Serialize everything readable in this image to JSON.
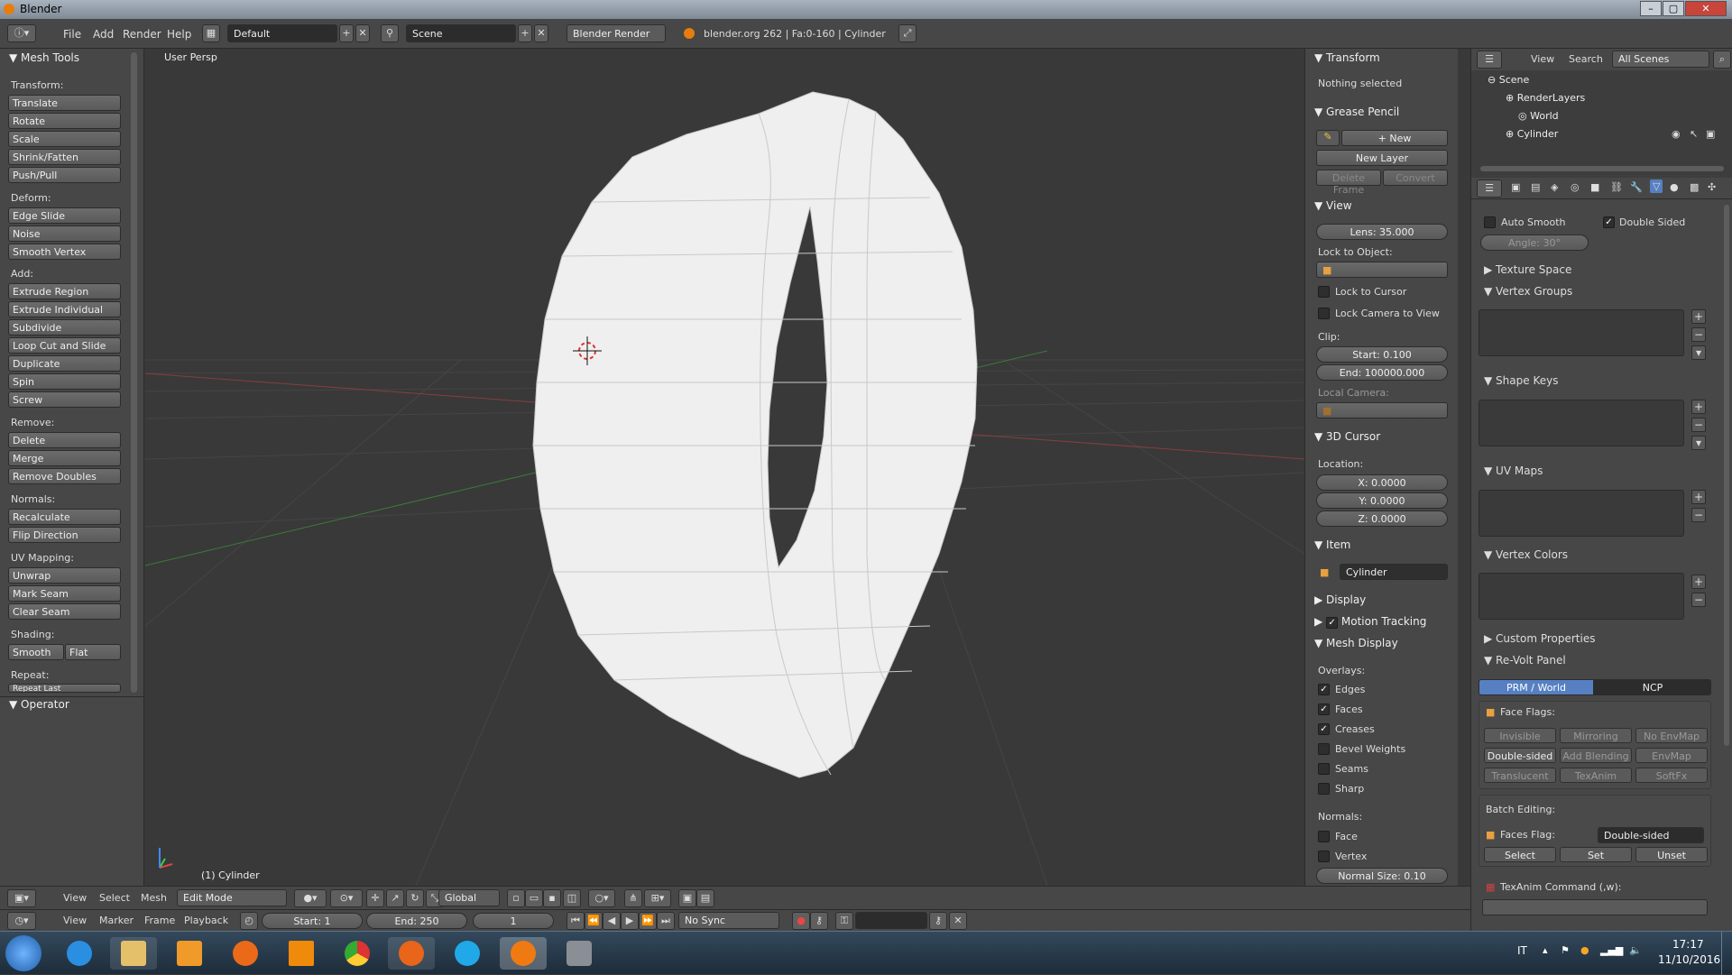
{
  "window": {
    "title": "Blender",
    "min": "–",
    "max": "▢",
    "close": "✕"
  },
  "topbar": {
    "menus": [
      "File",
      "Add",
      "Render",
      "Help"
    ],
    "layout": "Default",
    "scene": "Scene",
    "engine": "Blender Render",
    "info": "blender.org 262 | Fa:0-160 | Cylinder"
  },
  "toolshelf": {
    "title": "Mesh Tools",
    "groups": {
      "transform": "Transform:",
      "deform": "Deform:",
      "add": "Add:",
      "remove": "Remove:",
      "normals": "Normals:",
      "uv": "UV Mapping:",
      "shading": "Shading:",
      "repeat": "Repeat:"
    },
    "buttons": {
      "translate": "Translate",
      "rotate": "Rotate",
      "scale": "Scale",
      "shrink": "Shrink/Fatten",
      "push": "Push/Pull",
      "edge_slide": "Edge Slide",
      "noise": "Noise",
      "smooth_vertex": "Smooth Vertex",
      "extrude_region": "Extrude Region",
      "extrude_individual": "Extrude Individual",
      "subdivide": "Subdivide",
      "loop_cut": "Loop Cut and Slide",
      "duplicate": "Duplicate",
      "spin": "Spin",
      "screw": "Screw",
      "delete": "Delete",
      "merge": "Merge",
      "remove_doubles": "Remove Doubles",
      "recalculate": "Recalculate",
      "flip": "Flip Direction",
      "unwrap": "Unwrap",
      "mark_seam": "Mark Seam",
      "clear_seam": "Clear Seam",
      "smooth": "Smooth",
      "flat": "Flat",
      "repeat_last": "Repeat Last"
    },
    "operator": "Operator"
  },
  "viewport": {
    "label": "User Persp",
    "object": "(1) Cylinder"
  },
  "npanel": {
    "transform": "Transform",
    "nothing_selected": "Nothing selected",
    "grease_pencil": "Grease Pencil",
    "gp_new": "New",
    "new_layer": "New Layer",
    "delete_frame": "Delete Frame",
    "convert": "Convert",
    "view": "View",
    "lens": "Lens: 35.000",
    "lock_object": "Lock to Object:",
    "lock_cursor": "Lock to Cursor",
    "lock_camera": "Lock Camera to View",
    "clip": "Clip:",
    "clip_start": "Start: 0.100",
    "clip_end": "End: 100000.000",
    "local_camera": "Local Camera:",
    "cursor": "3D Cursor",
    "location": "Location:",
    "x": "X: 0.0000",
    "y": "Y: 0.0000",
    "z": "Z: 0.0000",
    "item": "Item",
    "item_name": "Cylinder",
    "display": "Display",
    "motion_tracking": "Motion Tracking",
    "mesh_display": "Mesh Display",
    "overlays": "Overlays:",
    "edges": "Edges",
    "faces": "Faces",
    "creases": "Creases",
    "bevel_weights": "Bevel Weights",
    "seams": "Seams",
    "sharp": "Sharp",
    "normals": "Normals:",
    "face": "Face",
    "vertex": "Vertex",
    "normal_size": "Normal Size: 0.10"
  },
  "outliner": {
    "view": "View",
    "search": "Search",
    "filter": "All Scenes",
    "items": {
      "scene": "Scene",
      "renderlayers": "RenderLayers",
      "world": "World",
      "cylinder": "Cylinder"
    }
  },
  "props": {
    "auto_smooth": "Auto Smooth",
    "double_sided": "Double Sided",
    "angle": "Angle: 30°",
    "texture_space": "Texture Space",
    "vertex_groups": "Vertex Groups",
    "shape_keys": "Shape Keys",
    "uv_maps": "UV Maps",
    "vertex_colors": "Vertex Colors",
    "custom_props": "Custom Properties",
    "revolt": "Re-Volt Panel",
    "prm": "PRM / World",
    "ncp": "NCP",
    "face_flags": "Face Flags:",
    "flags": [
      "Invisible",
      "Mirroring",
      "No EnvMap",
      "Double-sided",
      "Add Blending",
      "EnvMap",
      "Translucent",
      "TexAnim",
      "SoftFx"
    ],
    "batch": "Batch Editing:",
    "faces_flag": "Faces Flag:",
    "faces_flag_val": "Double-sided",
    "select": "Select",
    "set": "Set",
    "unset": "Unset",
    "texanim": "TexAnim Command (,w):"
  },
  "viewheader": {
    "view": "View",
    "select": "Select",
    "mesh": "Mesh",
    "mode": "Edit Mode",
    "orient": "Global"
  },
  "timeline": {
    "view": "View",
    "marker": "Marker",
    "frame": "Frame",
    "playback": "Playback",
    "start": "Start: 1",
    "end": "End: 250",
    "current": "1",
    "sync": "No Sync"
  },
  "taskbar": {
    "lang": "IT",
    "time": "17:17",
    "date": "11/10/2016"
  },
  "colors": {
    "mesh": "#efefef",
    "accent": "#5680c2",
    "grid": "#454545"
  }
}
